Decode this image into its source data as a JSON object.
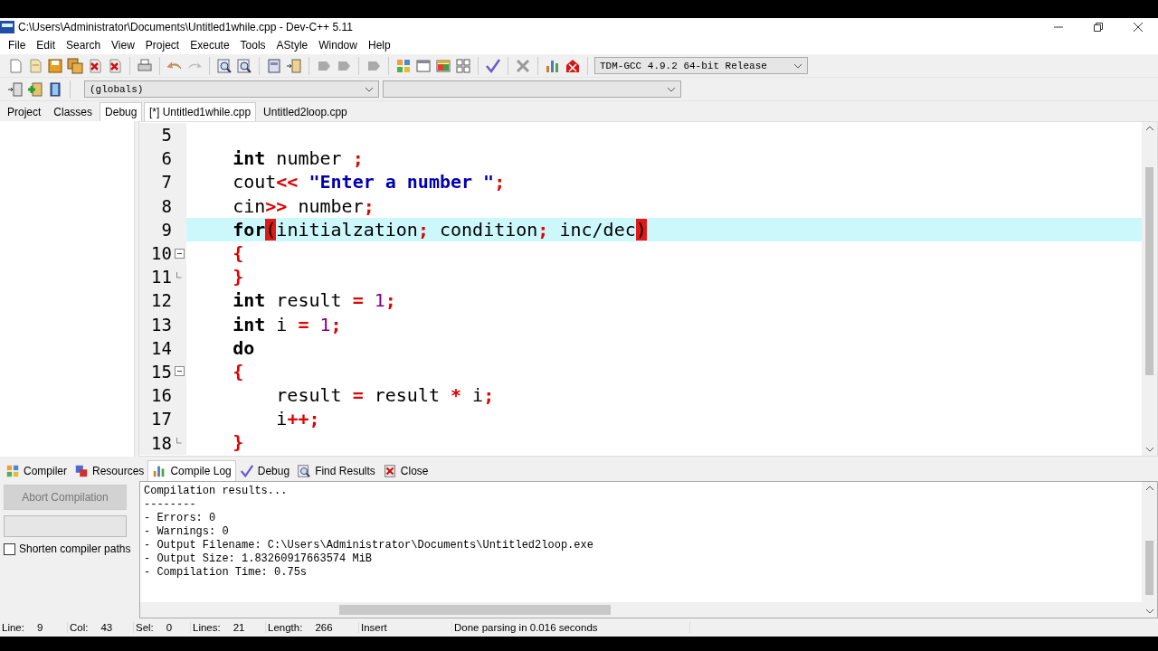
{
  "window": {
    "title": "C:\\Users\\Administrator\\Documents\\Untitled1while.cpp - Dev-C++ 5.11"
  },
  "menu": [
    "File",
    "Edit",
    "Search",
    "View",
    "Project",
    "Execute",
    "Tools",
    "AStyle",
    "Window",
    "Help"
  ],
  "toolbar": {
    "compiler": "TDM-GCC 4.9.2 64-bit Release",
    "scope": "(globals)"
  },
  "side_tabs": [
    {
      "label": "Project",
      "selected": false
    },
    {
      "label": "Classes",
      "selected": false
    },
    {
      "label": "Debug",
      "selected": true
    }
  ],
  "editor_tabs": [
    {
      "label": "[*] Untitled1while.cpp",
      "selected": true
    },
    {
      "label": "Untitled2loop.cpp",
      "selected": false
    }
  ],
  "code_lines": [
    {
      "number": "5",
      "current": false,
      "fold_start": false,
      "fold_end": false
    },
    {
      "number": "6",
      "current": false,
      "fold_start": false,
      "fold_end": false,
      "tokens": [
        {
          "t": "    int",
          "kind": "kw"
        },
        {
          "t": " number ",
          "kind": "id"
        },
        {
          "t": ";",
          "kind": "op"
        }
      ]
    },
    {
      "number": "7",
      "current": false,
      "fold_start": false,
      "fold_end": false,
      "tokens": [
        {
          "t": "    cout",
          "kind": "id"
        },
        {
          "t": "<<",
          "kind": "op"
        },
        {
          "t": " \"Enter a number \"",
          "kind": "str"
        },
        {
          "t": ";",
          "kind": "op"
        }
      ]
    },
    {
      "number": "8",
      "current": false,
      "fold_start": false,
      "fold_end": false,
      "tokens": [
        {
          "t": "    cin",
          "kind": "id"
        },
        {
          "t": ">>",
          "kind": "op"
        },
        {
          "t": " number",
          "kind": "id"
        },
        {
          "t": ";",
          "kind": "op"
        }
      ]
    },
    {
      "number": "9",
      "current": true,
      "fold_start": false,
      "fold_end": false,
      "tokens": [
        {
          "t": "    for",
          "kind": "kw"
        },
        {
          "t": "(",
          "kind": "match"
        },
        {
          "t": "initialzation",
          "kind": "id"
        },
        {
          "t": ";",
          "kind": "op"
        },
        {
          "t": " condition",
          "kind": "id"
        },
        {
          "t": ";",
          "kind": "op"
        },
        {
          "t": " inc/dec",
          "kind": "id"
        },
        {
          "t": ")",
          "kind": "match"
        }
      ]
    },
    {
      "number": "10",
      "current": false,
      "fold_start": true,
      "fold_end": false,
      "tokens": [
        {
          "t": "    {",
          "kind": "op"
        }
      ]
    },
    {
      "number": "11",
      "current": false,
      "fold_start": false,
      "fold_end": true,
      "tokens": [
        {
          "t": "    }",
          "kind": "op"
        }
      ]
    },
    {
      "number": "12",
      "current": false,
      "fold_start": false,
      "fold_end": false,
      "tokens": [
        {
          "t": "    int",
          "kind": "kw"
        },
        {
          "t": " result ",
          "kind": "id"
        },
        {
          "t": "=",
          "kind": "op"
        },
        {
          "t": " 1",
          "kind": "num"
        },
        {
          "t": ";",
          "kind": "op"
        }
      ]
    },
    {
      "number": "13",
      "current": false,
      "fold_start": false,
      "fold_end": false,
      "tokens": [
        {
          "t": "    int",
          "kind": "kw"
        },
        {
          "t": " i ",
          "kind": "id"
        },
        {
          "t": "=",
          "kind": "op"
        },
        {
          "t": " 1",
          "kind": "num"
        },
        {
          "t": ";",
          "kind": "op"
        }
      ]
    },
    {
      "number": "14",
      "current": false,
      "fold_start": false,
      "fold_end": false,
      "tokens": [
        {
          "t": "    do",
          "kind": "kw"
        }
      ]
    },
    {
      "number": "15",
      "current": false,
      "fold_start": true,
      "fold_end": false,
      "tokens": [
        {
          "t": "    {",
          "kind": "op"
        }
      ]
    },
    {
      "number": "16",
      "current": false,
      "fold_start": false,
      "fold_end": false,
      "tokens": [
        {
          "t": "        result ",
          "kind": "id"
        },
        {
          "t": "=",
          "kind": "op"
        },
        {
          "t": " result ",
          "kind": "id"
        },
        {
          "t": "*",
          "kind": "op"
        },
        {
          "t": " i",
          "kind": "id"
        },
        {
          "t": ";",
          "kind": "op"
        }
      ]
    },
    {
      "number": "17",
      "current": false,
      "fold_start": false,
      "fold_end": false,
      "tokens": [
        {
          "t": "        i",
          "kind": "id"
        },
        {
          "t": "++;",
          "kind": "op"
        }
      ]
    },
    {
      "number": "18",
      "current": false,
      "fold_start": false,
      "fold_end": true,
      "tokens": [
        {
          "t": "    }",
          "kind": "op"
        }
      ]
    }
  ],
  "bottom_tabs": [
    {
      "label": "Compiler",
      "selected": false
    },
    {
      "label": "Resources",
      "selected": false
    },
    {
      "label": "Compile Log",
      "selected": true
    },
    {
      "label": "Debug",
      "selected": false
    },
    {
      "label": "Find Results",
      "selected": false
    },
    {
      "label": "Close",
      "selected": false
    }
  ],
  "abort_button": {
    "label": "Abort Compilation",
    "disabled": true
  },
  "progress": {
    "level": 0
  },
  "shorten_paths": {
    "label": "Shorten compiler paths",
    "checked": false
  },
  "log_lines": [
    "Compilation results...",
    "--------",
    "- Errors: 0",
    "- Warnings: 0",
    "- Output Filename: C:\\Users\\Administrator\\Documents\\Untitled2loop.exe",
    "- Output Size: 1.83260917663574 MiB",
    "- Compilation Time: 0.75s"
  ],
  "status_bar": [
    {
      "label": "Line:",
      "value": "9"
    },
    {
      "label": "Col:",
      "value": "43"
    },
    {
      "label": "Sel:",
      "value": "0"
    },
    {
      "label": "Lines:",
      "value": "21"
    },
    {
      "label": "Length:",
      "value": "266"
    },
    {
      "value": "Insert"
    },
    {
      "value": "Done parsing in 0.016 seconds"
    }
  ]
}
